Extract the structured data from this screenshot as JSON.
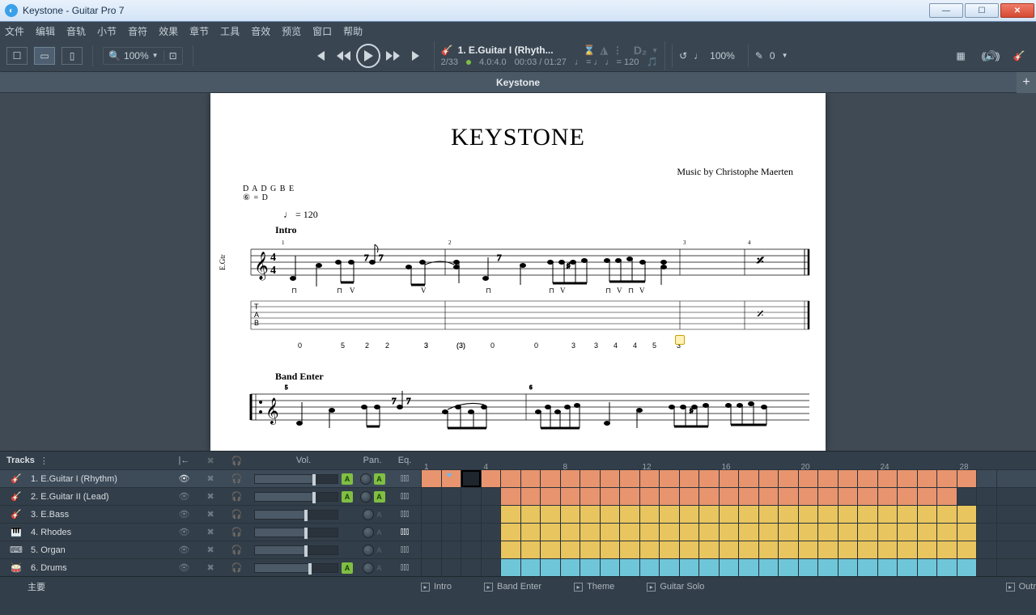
{
  "window": {
    "title": "Keystone - Guitar Pro 7"
  },
  "menu": [
    "文件",
    "编辑",
    "音轨",
    "小节",
    "音符",
    "效果",
    "章节",
    "工具",
    "音效",
    "预览",
    "窗口",
    "帮助"
  ],
  "toolbar": {
    "zoom": "100%",
    "track_label": "1. E.Guitar I (Rhyth...",
    "bar_pos": "2/33",
    "time_sig": "4.0:4.0",
    "time": "00:03 / 01:27",
    "tempo_marking": "♩ = ♩  ♩ = 120",
    "speed_pct": "100%",
    "pitch_val": "0",
    "capo": "D₂"
  },
  "tab_title": "Keystone",
  "score": {
    "title": "KEYSTONE",
    "credit": "Music by Christophe Maerten",
    "tuning": "D A D G B E",
    "tuning_note": "⑥ = D",
    "tempo": "♩ = 120",
    "sec1": "Intro",
    "sec2": "Band Enter",
    "track_short": "E.Gtr",
    "tab1": [
      {
        "p": 62,
        "t": "0"
      },
      {
        "p": 115,
        "t": "5"
      },
      {
        "p": 145,
        "t": "2"
      },
      {
        "p": 170,
        "t": "2"
      },
      {
        "p": 218,
        "t": "3"
      },
      {
        "p": 218,
        "t2": "3"
      },
      {
        "p": 258,
        "t": "(3)"
      },
      {
        "p": 258,
        "t2": "(3)"
      },
      {
        "p": 300,
        "t": "0"
      },
      {
        "p": 354,
        "t": "0"
      },
      {
        "p": 400,
        "t": "3"
      },
      {
        "p": 428,
        "t": "3"
      },
      {
        "p": 452,
        "t": "4"
      },
      {
        "p": 476,
        "t": "4"
      },
      {
        "p": 500,
        "t": "5"
      },
      {
        "p": 530,
        "t": "3"
      }
    ]
  },
  "trackpanel": {
    "header": {
      "name": "Tracks",
      "vol": "Vol.",
      "pan": "Pan.",
      "eq": "Eq."
    },
    "ruler": [
      1,
      4,
      8,
      12,
      16,
      20,
      24,
      28
    ],
    "tracks": [
      {
        "icon": "🎸",
        "name": "1. E.Guitar I (Rhythm)",
        "vol": 70,
        "auto": true,
        "panAuto": true,
        "color": "#e8946e",
        "start": 0,
        "end": 28,
        "cursor": 2,
        "sel": true,
        "eye": true
      },
      {
        "icon": "🎸",
        "name": "2. E.Guitar II (Lead)",
        "vol": 70,
        "auto": true,
        "panAuto": true,
        "color": "#e8946e",
        "start": 4,
        "end": 27
      },
      {
        "icon": "🎸",
        "name": "3. E.Bass",
        "vol": 60,
        "color": "#e8c55e",
        "start": 4,
        "end": 28
      },
      {
        "icon": "🎹",
        "name": "4. Rhodes",
        "vol": 60,
        "color": "#e8c55e",
        "start": 4,
        "end": 28,
        "eqOn": true
      },
      {
        "icon": "⌨",
        "name": "5. Organ",
        "vol": 60,
        "color": "#e8c55e",
        "start": 4,
        "end": 28
      },
      {
        "icon": "🥁",
        "name": "6. Drums",
        "vol": 65,
        "auto": true,
        "color": "#6fc6d9",
        "start": 4,
        "end": 28
      }
    ],
    "footer_label": "主要",
    "markers": [
      {
        "pos": 0,
        "label": "Intro"
      },
      {
        "pos": 4,
        "label": "Band Enter"
      },
      {
        "pos": 8,
        "label": "Theme"
      },
      {
        "pos": 12,
        "label": "Guitar Solo"
      },
      {
        "pos": 28,
        "label": "Outr",
        "right": true
      }
    ]
  }
}
